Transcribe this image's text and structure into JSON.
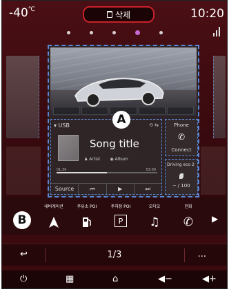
{
  "status": {
    "temperature": "-40",
    "temperature_unit": "℃",
    "clock": "10:20",
    "delete_label": "삭제"
  },
  "page_dots": {
    "count": 5,
    "active_index": 3
  },
  "widgets": {
    "callout_a": "A",
    "music": {
      "source_name": "USB",
      "title": "Song title",
      "artist": "Artist",
      "album": "Album",
      "elapsed": "01:30",
      "duration": "03:00",
      "progress": 0.5,
      "source_button": "Source"
    },
    "phone": {
      "title": "Phone",
      "action": "Connect"
    },
    "eco": {
      "title": "Driving eco 2",
      "value": "-- / 100"
    }
  },
  "shortcuts": {
    "callout_b": "B",
    "items": [
      {
        "label": "내비게이션",
        "icon": "navigation-arrow-icon"
      },
      {
        "label": "주유소 POI",
        "icon": "fuel-pump-icon"
      },
      {
        "label": "주차장 POI",
        "icon": "parking-icon"
      },
      {
        "label": "오디오",
        "icon": "music-note-icon"
      },
      {
        "label": "전화",
        "icon": "phone-icon"
      }
    ]
  },
  "pager": {
    "page_indicator": "1/3",
    "more": "..."
  },
  "colors": {
    "accent_red": "#c9222a",
    "active_dot": "#c86ad6",
    "widget_border": "#5a88d6"
  }
}
